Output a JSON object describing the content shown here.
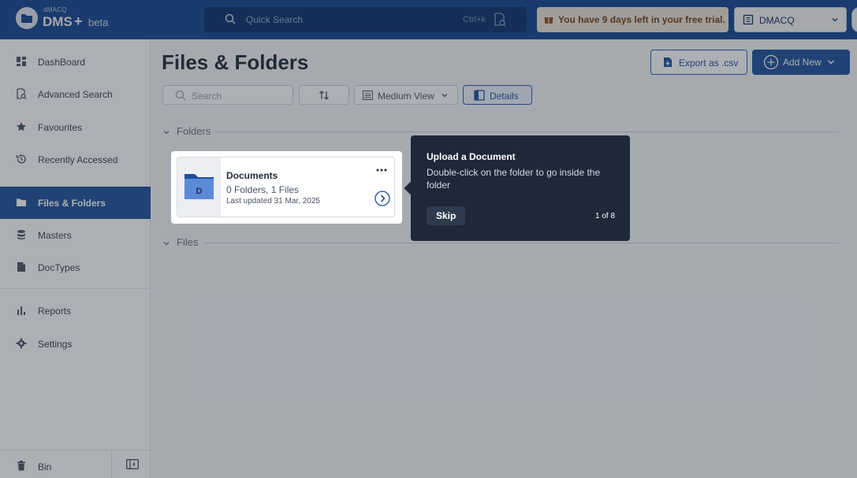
{
  "brand": {
    "small": "dMACQ",
    "name": "DMS",
    "plus": "+",
    "tag": "beta"
  },
  "header": {
    "search_placeholder": "Quick Search",
    "search_shortcut": "Ctrl+k",
    "trial_message": "You have 9 days left in your free trial.",
    "org_name": "DMACQ"
  },
  "sidebar": {
    "items": [
      {
        "label": "DashBoard",
        "icon": "dashboard-icon"
      },
      {
        "label": "Advanced Search",
        "icon": "advanced-search-icon"
      },
      {
        "label": "Favourites",
        "icon": "star-icon"
      },
      {
        "label": "Recently Accessed",
        "icon": "history-icon"
      },
      {
        "label": "Files & Folders",
        "icon": "folder-icon",
        "active": true
      },
      {
        "label": "Masters",
        "icon": "database-icon"
      },
      {
        "label": "DocTypes",
        "icon": "doctype-icon"
      },
      {
        "label": "Reports",
        "icon": "bar-chart-icon"
      },
      {
        "label": "Settings",
        "icon": "gear-icon"
      }
    ],
    "bin_label": "Bin"
  },
  "page": {
    "title": "Files & Folders",
    "export_label": "Export as .csv",
    "add_new_label": "Add New"
  },
  "toolbar": {
    "search_placeholder": "Search",
    "view_label": "Medium View",
    "details_label": "Details"
  },
  "sections": {
    "folders_label": "Folders",
    "files_label": "Files"
  },
  "folders": [
    {
      "name": "Documents",
      "initial": "D",
      "counts": "0 Folders, 1 Files",
      "updated": "Last updated 31 Mar, 2025"
    }
  ],
  "tour": {
    "title": "Upload a Document",
    "body": "Double-click on the folder to go inside the folder",
    "skip_label": "Skip",
    "step": "1 of 8"
  },
  "colors": {
    "primary": "#1e4f9c",
    "trial_bg": "#f7efe2",
    "tooltip_bg": "#1d2838"
  }
}
